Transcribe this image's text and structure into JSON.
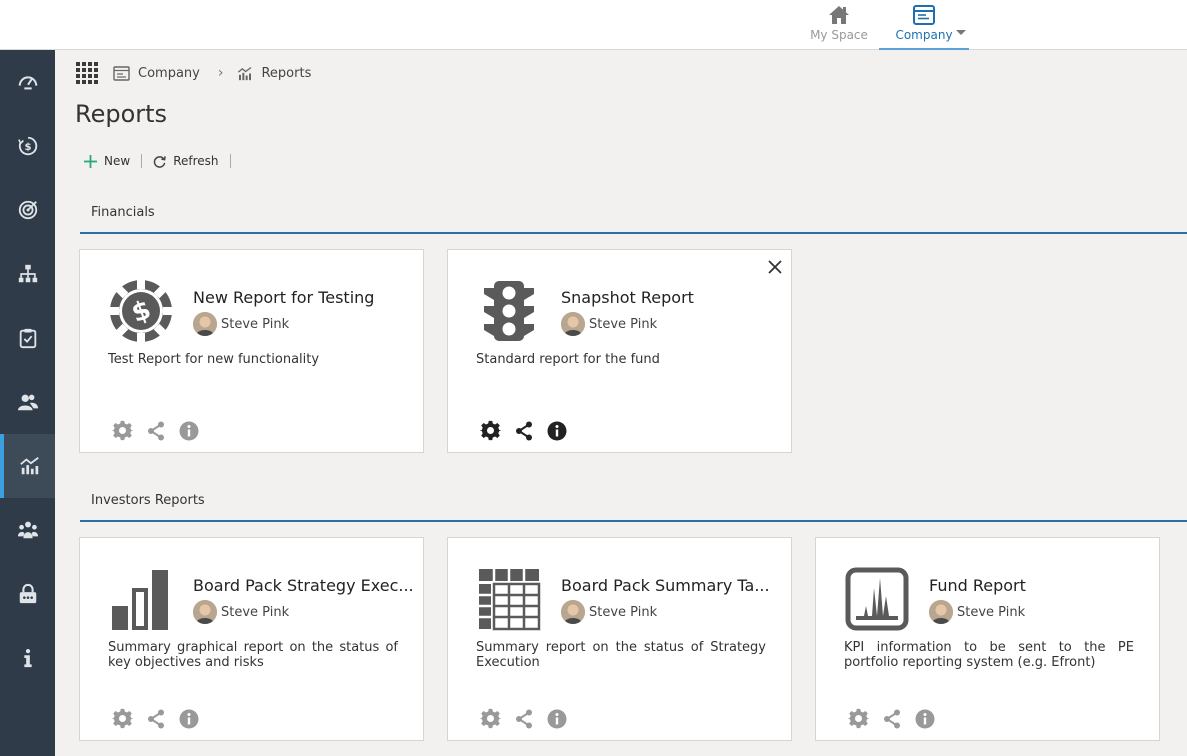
{
  "topnav": {
    "myspace_label": "My Space",
    "company_label": "Company"
  },
  "sidebar": {
    "items": [
      {
        "icon": "dashboard-icon"
      },
      {
        "icon": "finance-icon"
      },
      {
        "icon": "target-icon"
      },
      {
        "icon": "org-chart-icon"
      },
      {
        "icon": "clipboard-icon"
      },
      {
        "icon": "users-icon"
      },
      {
        "icon": "reports-icon",
        "active": true
      },
      {
        "icon": "team-icon"
      },
      {
        "icon": "lock-icon"
      },
      {
        "icon": "info-icon"
      }
    ],
    "accent": "#3aa0e0"
  },
  "breadcrumb": {
    "company": "Company",
    "reports": "Reports"
  },
  "page": {
    "title": "Reports"
  },
  "toolbar": {
    "new_label": "New",
    "refresh_label": "Refresh"
  },
  "sections": [
    {
      "title": "Financials",
      "cards": [
        {
          "title": "New Report for Testing",
          "author": "Steve Pink",
          "description": "Test Report for new functionality",
          "icon": "casino-chip-dollar-icon"
        },
        {
          "title": "Snapshot Report",
          "author": "Steve Pink",
          "description": "Standard report for the fund",
          "icon": "traffic-light-icon"
        }
      ]
    },
    {
      "title": "Investors Reports",
      "cards": [
        {
          "title": "Board Pack Strategy Exec...",
          "author": "Steve Pink",
          "description": "Summary graphical report on the status of key objectives and risks",
          "icon": "bar-chart-icon"
        },
        {
          "title": "Board Pack Summary Ta...",
          "author": "Steve Pink",
          "description": "Summary report on the status of Strategy Execution",
          "icon": "table-grid-icon"
        },
        {
          "title": "Fund Report",
          "author": "Steve Pink",
          "description": "KPI information to be sent to the PE portfolio reporting system (e.g. Efront)",
          "icon": "kpi-chart-icon"
        }
      ]
    }
  ],
  "colors": {
    "sidebar_bg": "#2f3b48",
    "section_underline": "#2c6fa3",
    "company_active": "#1f6fb0",
    "new_plus": "#2aa876"
  }
}
